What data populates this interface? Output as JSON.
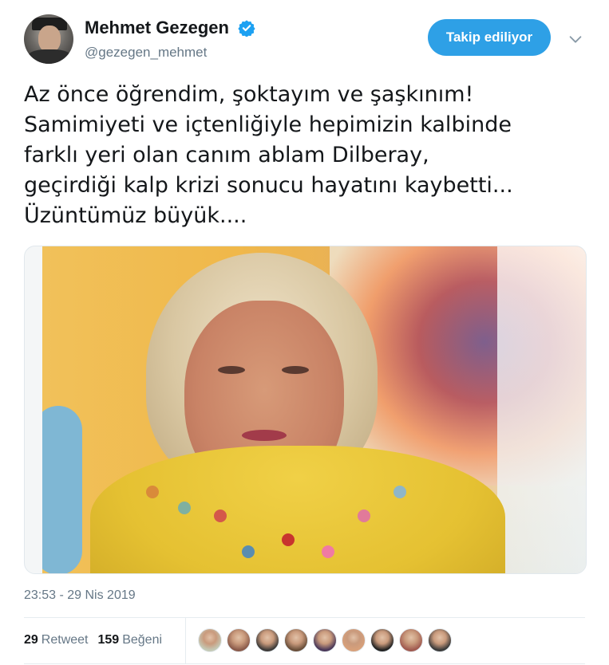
{
  "author": {
    "display_name": "Mehmet Gezegen",
    "handle": "@gezegen_mehmet",
    "verified_icon": "verified-badge-icon"
  },
  "follow_button": {
    "label": "Takip ediliyor"
  },
  "menu_icon": "chevron-down-icon",
  "tweet": {
    "lines": [
      "Az önce öğrendim, şoktayım ve şaşkınım!",
      "Samimiyeti ve içtenliğiyle hepimizin kalbinde",
      "farklı yeri olan canım ablam Dilberay,",
      "geçirdiği kalp krizi sonucu hayatını kaybetti...",
      "Üzüntümüz büyük...."
    ]
  },
  "timestamp": "23:53 - 29 Nis 2019",
  "stats": {
    "retweets": {
      "count": "29",
      "label": "Retweet"
    },
    "likes": {
      "count": "159",
      "label": "Beğeni"
    }
  },
  "colors": {
    "accent": "#2ea0e6",
    "text": "#14171a",
    "muted": "#657786"
  },
  "likers": [
    {
      "color": "#c4c9b5"
    },
    {
      "color": "#8a5a4a"
    },
    {
      "color": "#3d3a38"
    },
    {
      "color": "#6a4f3a"
    },
    {
      "color": "#4a3858"
    },
    {
      "color": "#d8a07a"
    },
    {
      "color": "#222222"
    },
    {
      "color": "#a05a50"
    },
    {
      "color": "#3a3a3a"
    }
  ]
}
